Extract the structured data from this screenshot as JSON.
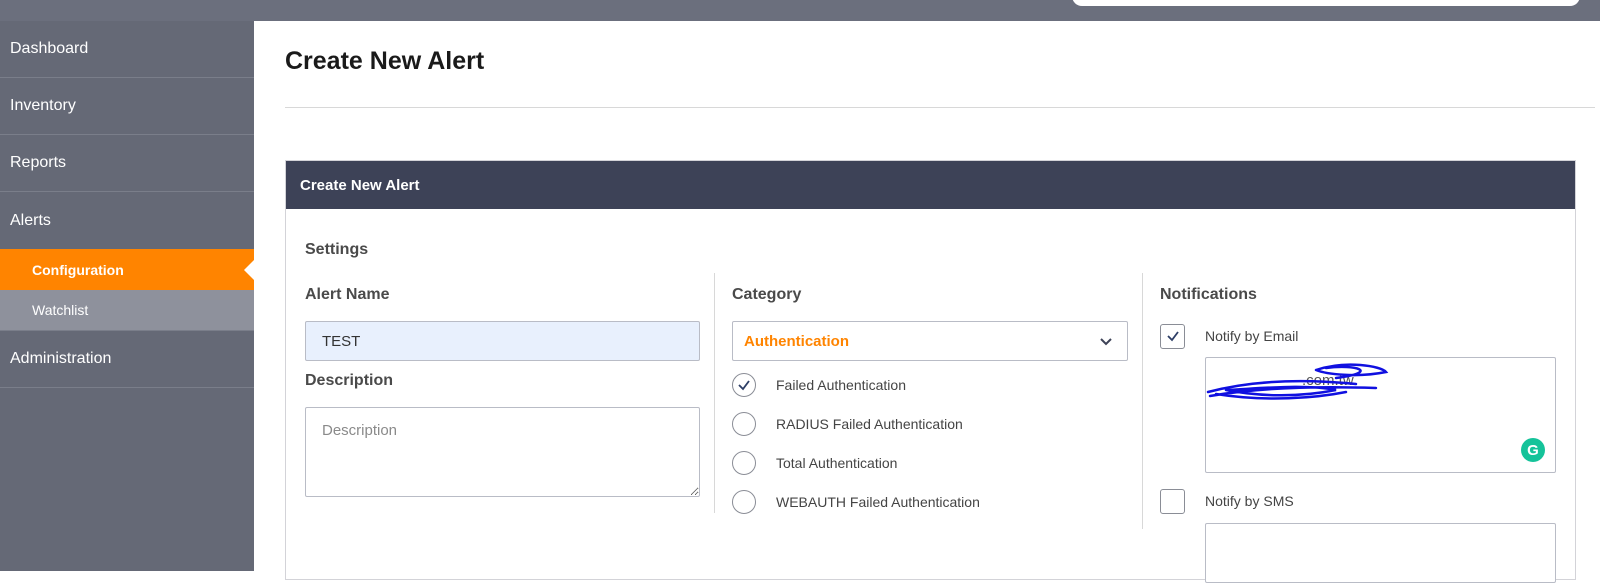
{
  "sidebar": {
    "items": [
      {
        "label": "Dashboard"
      },
      {
        "label": "Inventory"
      },
      {
        "label": "Reports"
      },
      {
        "label": "Alerts"
      }
    ],
    "sub_items": [
      {
        "label": "Configuration",
        "active": true
      },
      {
        "label": "Watchlist",
        "active": false
      }
    ],
    "after": [
      {
        "label": "Administration"
      }
    ]
  },
  "page": {
    "title": "Create New Alert"
  },
  "card": {
    "header": "Create New Alert",
    "section_title": "Settings",
    "alert_name": {
      "label": "Alert Name",
      "value": "TEST"
    },
    "description": {
      "label": "Description",
      "placeholder": "Description"
    },
    "category": {
      "label": "Category",
      "selected": "Authentication",
      "options": [
        {
          "label": "Failed Authentication",
          "checked": true
        },
        {
          "label": "RADIUS Failed Authentication",
          "checked": false
        },
        {
          "label": "Total Authentication",
          "checked": false
        },
        {
          "label": "WEBAUTH Failed Authentication",
          "checked": false
        }
      ]
    },
    "notifications": {
      "label": "Notifications",
      "email_label": "Notify by Email",
      "email_checked": true,
      "email_value": ".com.tw",
      "sms_label": "Notify by SMS",
      "sms_checked": false
    }
  },
  "colors": {
    "accent": "#ff8400",
    "header_bg": "#3d4257",
    "sidebar_bg": "#656976",
    "redaction": "#1010e0",
    "grammarly": "#15c39a"
  },
  "icons": {
    "chevron": "chevron-down-icon",
    "check": "check-icon",
    "grammarly": "grammarly-icon",
    "active_pointer": "triangle-pointer-icon"
  }
}
